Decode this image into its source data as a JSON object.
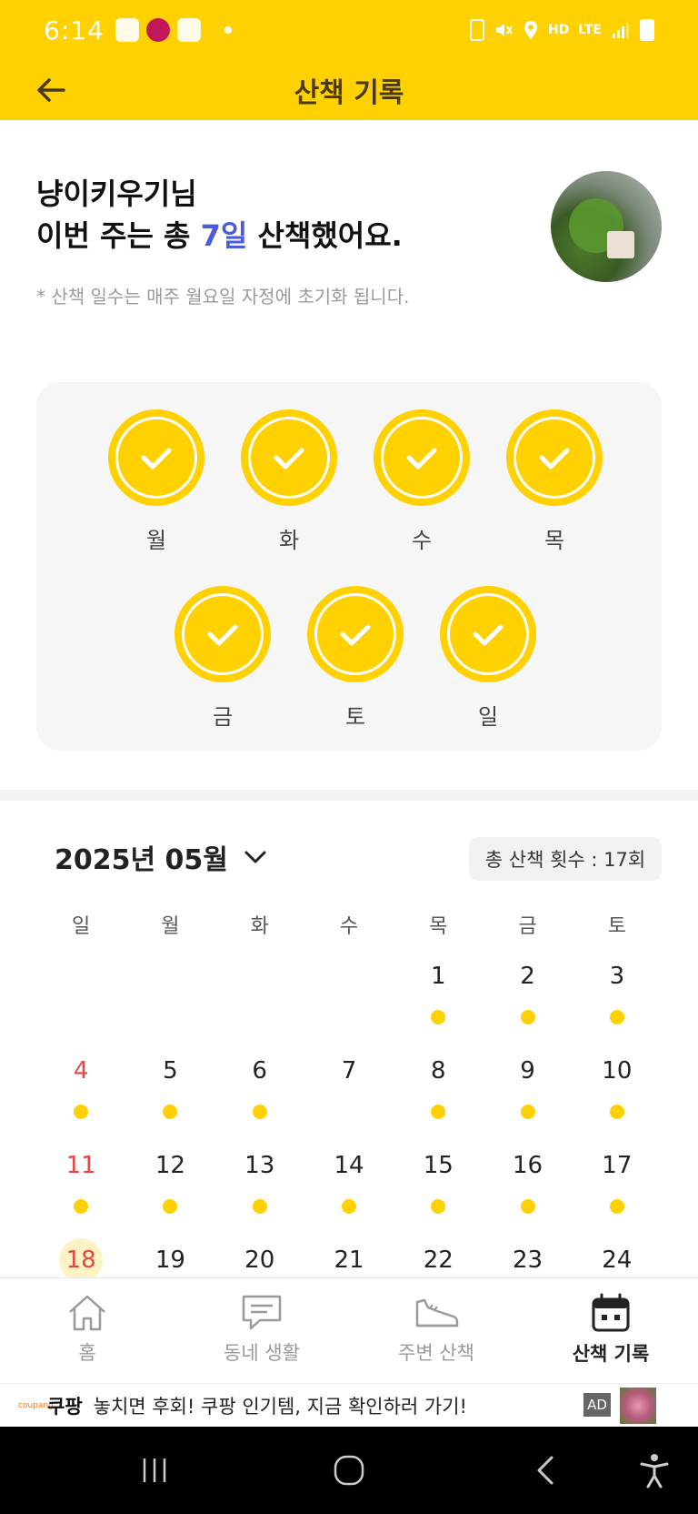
{
  "status_bar": {
    "time": "6:14",
    "hd_label": "HD",
    "lte_label": "LTE"
  },
  "app_bar": {
    "title": "산책 기록"
  },
  "intro": {
    "user_name": "냥이키우기님",
    "msg_prefix": "이번 주는 총 ",
    "msg_days": "7일",
    "msg_suffix": " 산책했어요.",
    "note": "* 산책 일수는 매주 월요일 자정에 초기화 됩니다."
  },
  "week": {
    "days": [
      {
        "label": "월",
        "checked": true
      },
      {
        "label": "화",
        "checked": true
      },
      {
        "label": "수",
        "checked": true
      },
      {
        "label": "목",
        "checked": true
      },
      {
        "label": "금",
        "checked": true
      },
      {
        "label": "토",
        "checked": true
      },
      {
        "label": "일",
        "checked": true
      }
    ]
  },
  "calendar": {
    "month_label": "2025년 05월",
    "total_label": "총 산책 횟수 : 17회",
    "weekdays": [
      "일",
      "월",
      "화",
      "수",
      "목",
      "금",
      "토"
    ],
    "rows": [
      [
        null,
        null,
        null,
        null,
        {
          "d": "1",
          "walk": true
        },
        {
          "d": "2",
          "walk": true
        },
        {
          "d": "3",
          "walk": true
        }
      ],
      [
        {
          "d": "4",
          "walk": true
        },
        {
          "d": "5",
          "walk": true
        },
        {
          "d": "6",
          "walk": true
        },
        {
          "d": "7",
          "walk": false
        },
        {
          "d": "8",
          "walk": true
        },
        {
          "d": "9",
          "walk": true
        },
        {
          "d": "10",
          "walk": true
        }
      ],
      [
        {
          "d": "11",
          "walk": true
        },
        {
          "d": "12",
          "walk": true
        },
        {
          "d": "13",
          "walk": true
        },
        {
          "d": "14",
          "walk": true
        },
        {
          "d": "15",
          "walk": true
        },
        {
          "d": "16",
          "walk": true
        },
        {
          "d": "17",
          "walk": true
        }
      ],
      [
        {
          "d": "18",
          "walk": false,
          "today": true
        },
        {
          "d": "19",
          "walk": false
        },
        {
          "d": "20",
          "walk": false
        },
        {
          "d": "21",
          "walk": false
        },
        {
          "d": "22",
          "walk": false
        },
        {
          "d": "23",
          "walk": false
        },
        {
          "d": "24",
          "walk": false
        }
      ]
    ]
  },
  "bottom_nav": {
    "tabs": [
      {
        "label": "홈",
        "icon": "home-icon"
      },
      {
        "label": "동네 생활",
        "icon": "chat-icon"
      },
      {
        "label": "주변 산책",
        "icon": "shoe-icon"
      },
      {
        "label": "산책 기록",
        "icon": "calendar-icon",
        "active": true
      }
    ]
  },
  "ad": {
    "brand": "쿠팡",
    "text": "놓치면 후회! 쿠팡 인기템, 지금 확인하러 가기!",
    "tag": "AD"
  },
  "colors": {
    "accent": "#FFD100",
    "highlight": "#4a5be0",
    "sunday": "#e24646"
  }
}
